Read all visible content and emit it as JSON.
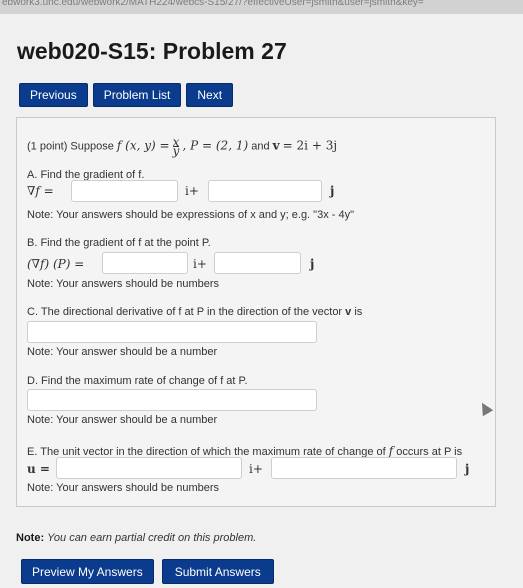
{
  "browser": {
    "url_fragment": "ebwork3.unc.edu/webwork2/MATH224/webcs-S15/27/?effectiveUser=jsmith&user=jsmith&key="
  },
  "header": {
    "title": "web020-S15: Problem 27"
  },
  "nav": {
    "previous": "Previous",
    "problem_list": "Problem List",
    "next": "Next"
  },
  "problem": {
    "points": "(1 point) Suppose",
    "f_def": "f (x, y) =",
    "frac_num": "x",
    "frac_den": "y",
    "p_def": ", P = (2, 1)",
    "and": "and",
    "v_label": "v",
    "v_def": "= 2i + 3j",
    "partA": {
      "prompt": "A. Find the gradient of f.",
      "lhs": "∇f =",
      "i_sep": "i+",
      "j_sep": "j",
      "note": "Note: Your answers should be expressions of x and y; e.g. \"3x - 4y\"",
      "answer_i": "",
      "answer_j": ""
    },
    "partB": {
      "prompt": "B. Find the gradient of f at the point P.",
      "lhs": "(∇f) (P) =",
      "i_sep": "i+",
      "j_sep": "j",
      "note": "Note: Your answers should be numbers",
      "answer_i": "",
      "answer_j": ""
    },
    "partC": {
      "prompt": "C. The directional derivative of f at P in the direction of the vector",
      "prompt_v": "v",
      "prompt_end": "is",
      "note": "Note: Your answer should be a number",
      "answer": ""
    },
    "partD": {
      "prompt": "D. Find the maximum rate of change of f at P.",
      "note": "Note: Your answer should be a number",
      "answer": ""
    },
    "partE": {
      "prompt": "E. The unit vector in the direction of which the maximum rate of change of",
      "prompt_f": "f",
      "prompt_end": "occurs at P is",
      "lhs": "u =",
      "i_sep": "i+",
      "j_sep": "j",
      "note": "Note: Your answers should be numbers",
      "answer_i": "",
      "answer_j": ""
    }
  },
  "footer": {
    "note_label": "Note:",
    "note_text": "You can earn partial credit on this problem.",
    "preview": "Preview My Answers",
    "submit": "Submit Answers"
  }
}
